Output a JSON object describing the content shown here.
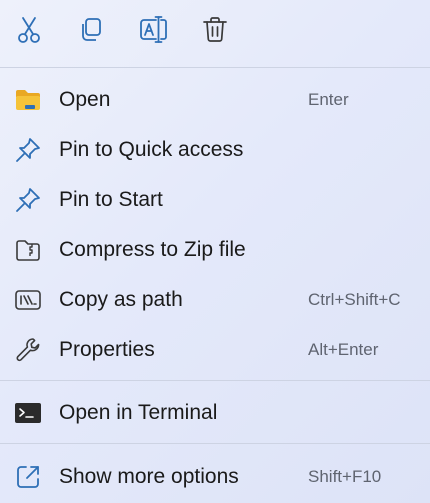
{
  "toolbar": {
    "buttons": [
      {
        "name": "cut",
        "icon": "scissors-icon"
      },
      {
        "name": "copy",
        "icon": "copy-icon"
      },
      {
        "name": "rename",
        "icon": "rename-icon"
      },
      {
        "name": "delete",
        "icon": "trash-icon"
      }
    ]
  },
  "colors": {
    "accent": "#2e6fb6",
    "folder_yellow": "#f5c339",
    "shortcut_text": "#5f6470"
  },
  "items": {
    "open": {
      "label": "Open",
      "shortcut": "Enter",
      "icon": "folder-icon"
    },
    "pin_quick": {
      "label": "Pin to Quick access",
      "icon": "pin-icon"
    },
    "pin_start": {
      "label": "Pin to Start",
      "icon": "pin-icon"
    },
    "compress": {
      "label": "Compress to Zip file",
      "icon": "zip-icon"
    },
    "copy_path": {
      "label": "Copy as path",
      "shortcut": "Ctrl+Shift+C",
      "icon": "path-icon"
    },
    "properties": {
      "label": "Properties",
      "shortcut": "Alt+Enter",
      "icon": "wrench-icon"
    },
    "terminal": {
      "label": "Open in Terminal",
      "icon": "terminal-icon"
    },
    "more": {
      "label": "Show more options",
      "shortcut": "Shift+F10",
      "icon": "external-icon"
    }
  }
}
